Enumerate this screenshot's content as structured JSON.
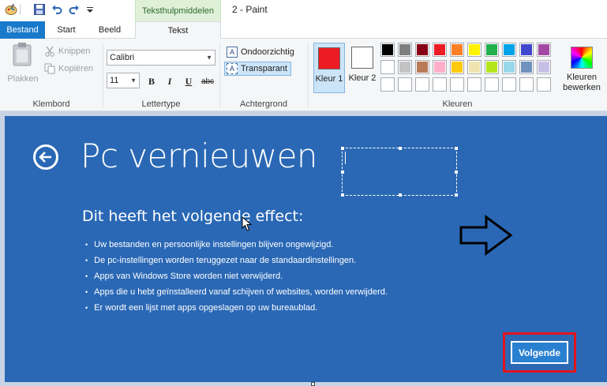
{
  "window": {
    "contextual_tab_group": "Teksthulpmiddelen",
    "title": "2 - Paint"
  },
  "tabs": {
    "file": "Bestand",
    "start": "Start",
    "view": "Beeld",
    "text": "Tekst"
  },
  "ribbon": {
    "clipboard": {
      "paste": "Plakken",
      "cut": "Knippen",
      "copy": "Kopiëren",
      "group": "Klembord"
    },
    "font": {
      "family": "Calibri",
      "size": "11",
      "bold": "B",
      "italic": "I",
      "underline": "U",
      "strike": "abc",
      "group": "Lettertype"
    },
    "background": {
      "opaque": "Ondoorzichtig",
      "transparent": "Transparant",
      "group": "Achtergrond"
    },
    "colors": {
      "color1_label": "Kleur 1",
      "color2_label": "Kleur 2",
      "color1": "#ed1c24",
      "color2": "#ffffff",
      "edit": "Kleuren bewerken",
      "group": "Kleuren",
      "palette": [
        "#000000",
        "#7f7f7f",
        "#880015",
        "#ed1c24",
        "#ff7f27",
        "#fff200",
        "#22b14c",
        "#00a2e8",
        "#3f48cc",
        "#a349a4",
        "#ffffff",
        "#c3c3c3",
        "#b97a57",
        "#ffaec9",
        "#ffc90e",
        "#efe4b0",
        "#b5e61d",
        "#99d9ea",
        "#7092be",
        "#c8bfe7",
        "#ffffff",
        "#ffffff",
        "#ffffff",
        "#ffffff",
        "#ffffff",
        "#ffffff",
        "#ffffff",
        "#ffffff",
        "#ffffff",
        "#ffffff"
      ]
    }
  },
  "canvas": {
    "title": "Pc vernieuwen",
    "subtitle": "Dit heeft het volgende effect:",
    "bullets": [
      "Uw bestanden en persoonlijke instellingen blijven ongewijzigd.",
      "De pc-instellingen worden teruggezet naar de standaardinstellingen.",
      "Apps van Windows Store worden niet verwijderd.",
      "Apps die u hebt geïnstalleerd vanaf schijven of websites, worden verwijderd.",
      "Er wordt een lijst met apps opgeslagen op uw bureaublad."
    ],
    "next_button": "Volgende",
    "background": "#2a68b5",
    "highlight": "#e2141d"
  }
}
